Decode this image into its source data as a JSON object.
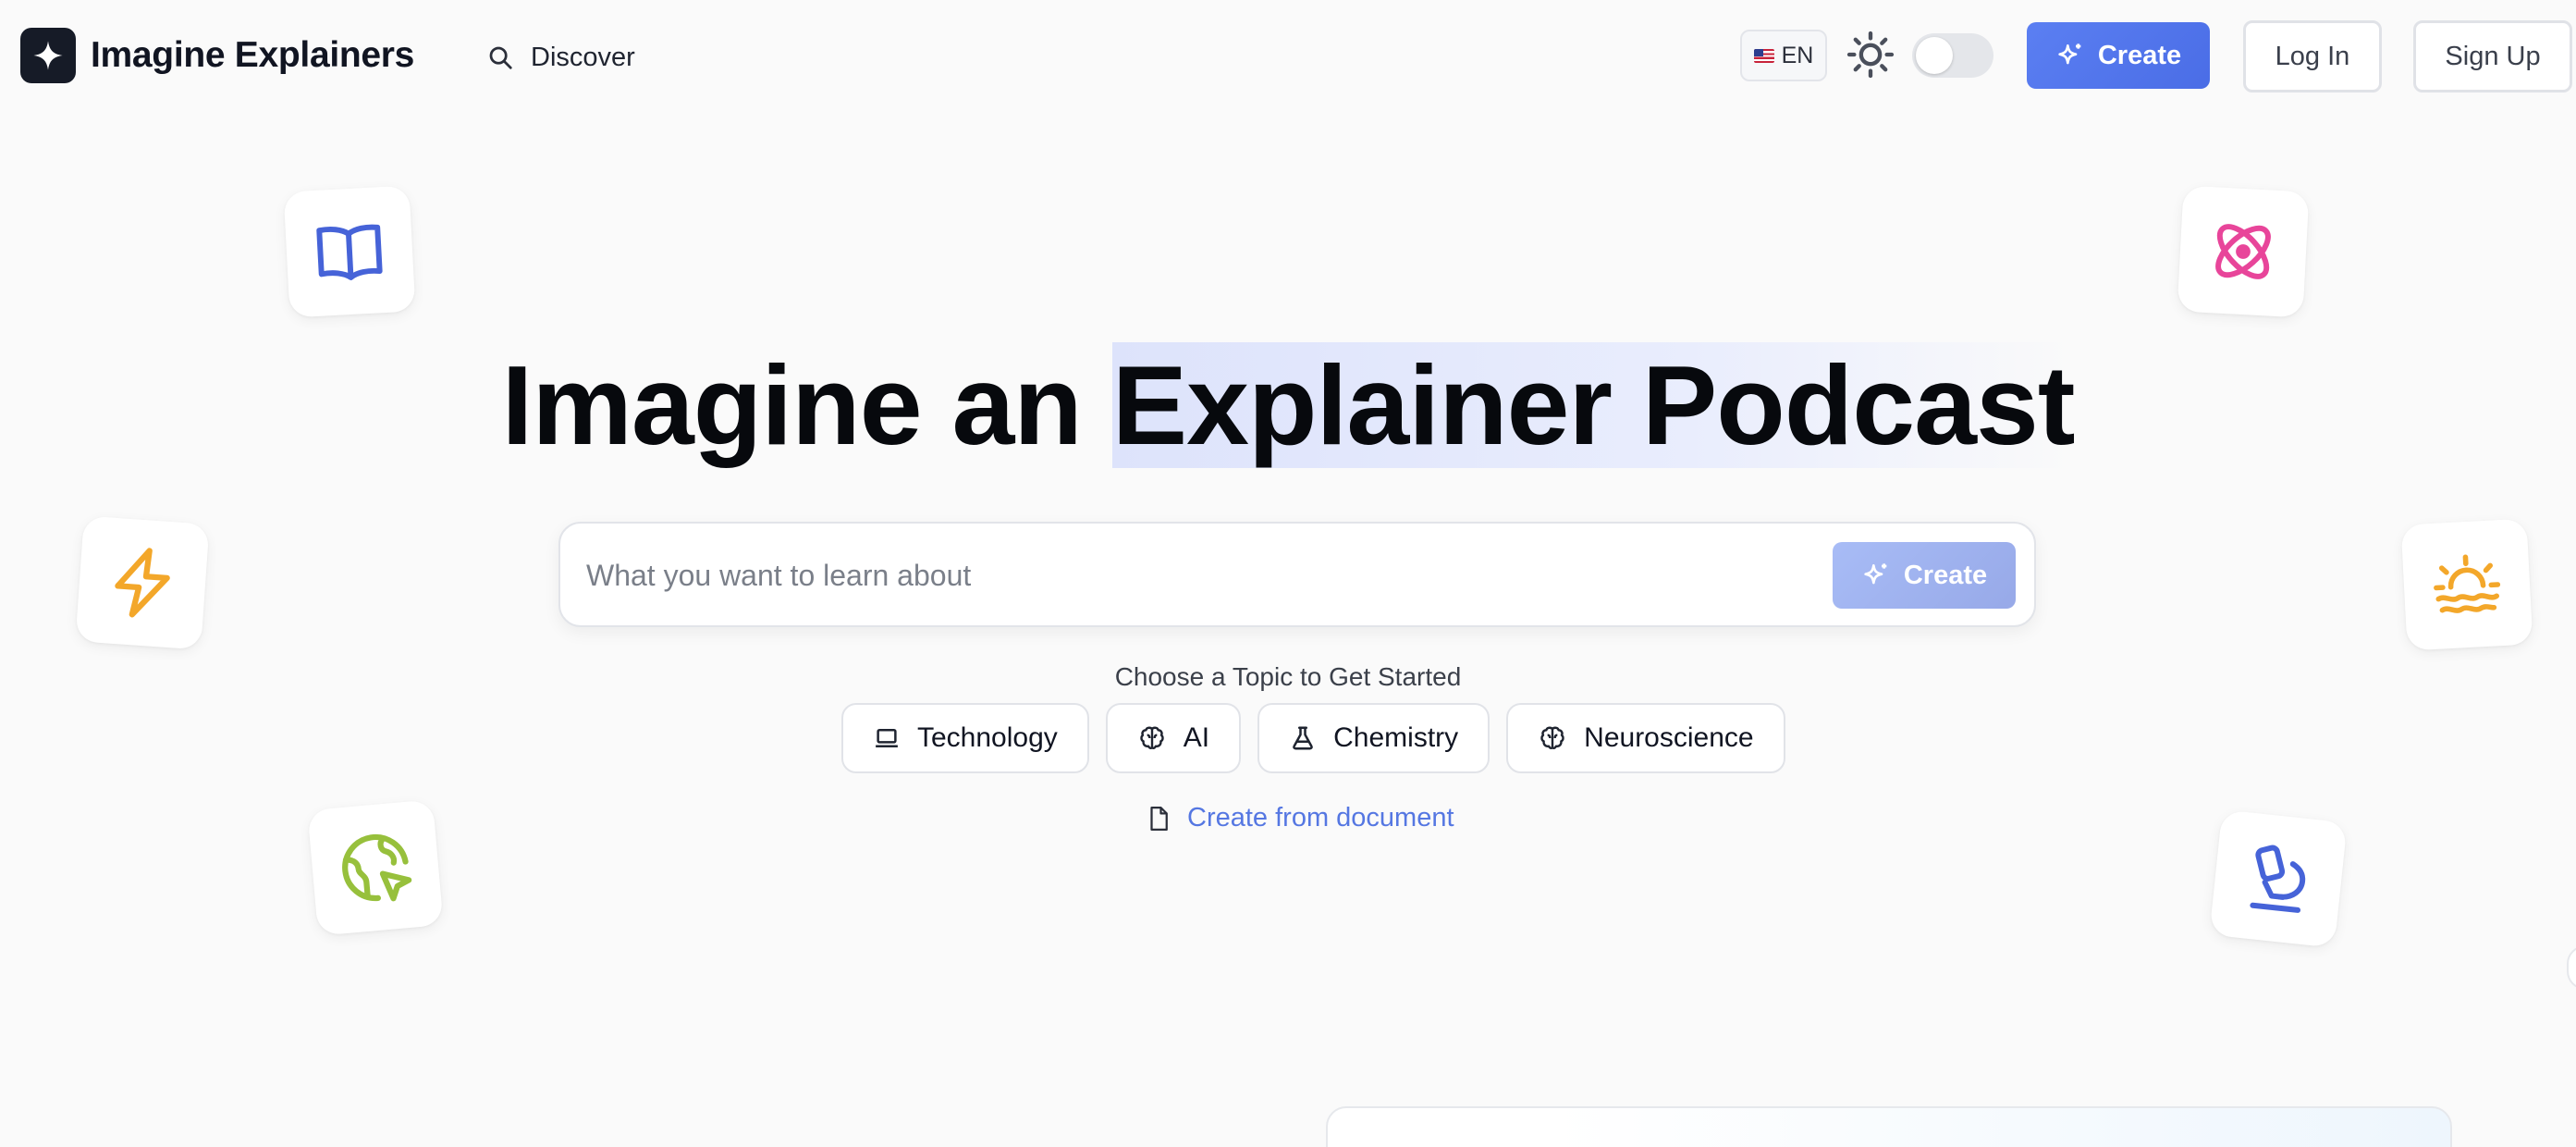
{
  "brand": {
    "name": "Imagine Explainers"
  },
  "nav": {
    "discover_label": "Discover"
  },
  "header": {
    "language_code": "EN",
    "create_label": "Create",
    "login_label": "Log In",
    "signup_label": "Sign Up"
  },
  "hero": {
    "title_part1": "Imagine an ",
    "title_highlight": "Explainer Podcast"
  },
  "search": {
    "placeholder": "What you want to learn about",
    "value": "",
    "create_label": "Create"
  },
  "topics": {
    "heading": "Choose a Topic to Get Started",
    "items": [
      {
        "label": "Technology",
        "icon": "laptop-icon"
      },
      {
        "label": "AI",
        "icon": "brain-icon"
      },
      {
        "label": "Chemistry",
        "icon": "flask-icon"
      },
      {
        "label": "Neuroscience",
        "icon": "brain-icon"
      }
    ]
  },
  "document_link": {
    "label": "Create from document",
    "icon": "document-icon"
  },
  "decorative_icons": [
    {
      "name": "book-icon",
      "color": "#4663d8"
    },
    {
      "name": "atom-icon",
      "color": "#e8459a"
    },
    {
      "name": "lightning-icon",
      "color": "#f3a72a"
    },
    {
      "name": "sunrise-icon",
      "color": "#f3a72a"
    },
    {
      "name": "globe-icon",
      "color": "#97c03c"
    },
    {
      "name": "microscope-icon",
      "color": "#4663d8"
    }
  ],
  "colors": {
    "accent": "#4f72ea",
    "link": "#5577e2",
    "background": "#fafafa"
  }
}
